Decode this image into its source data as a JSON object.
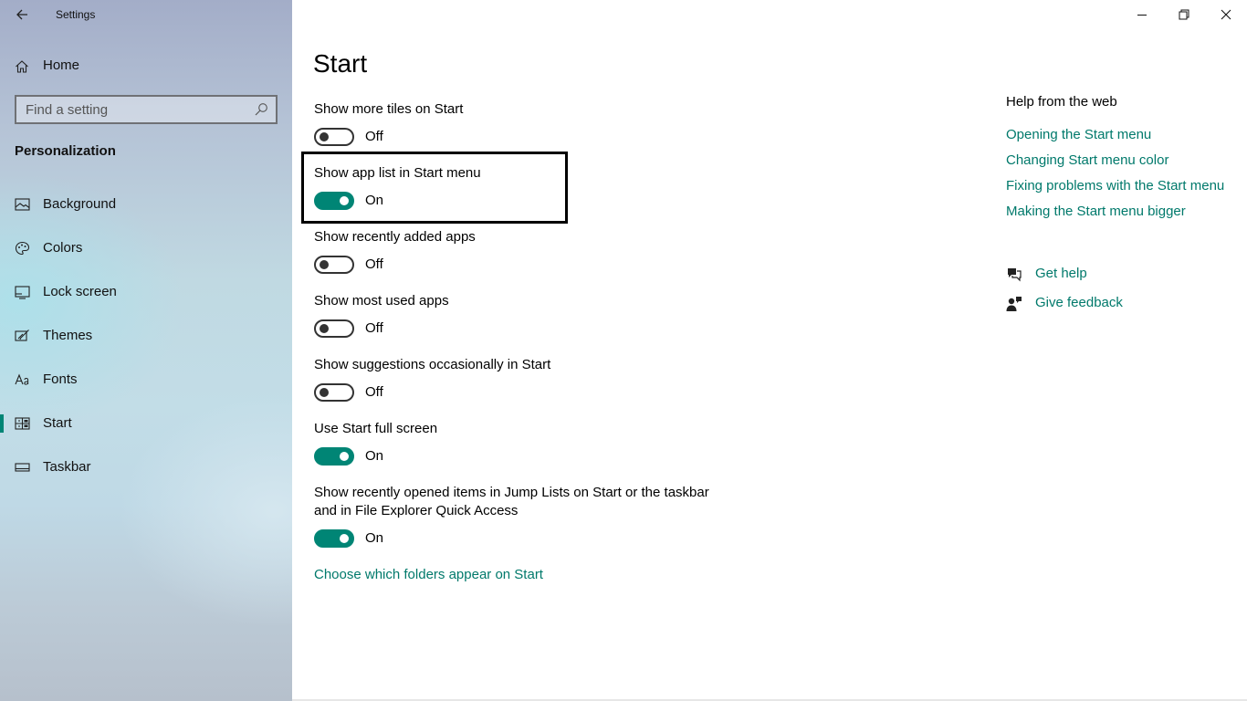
{
  "window": {
    "app_title": "Settings"
  },
  "sidebar": {
    "home_label": "Home",
    "search_placeholder": "Find a setting",
    "section_heading": "Personalization",
    "items": [
      {
        "label": "Background",
        "icon": "picture-icon"
      },
      {
        "label": "Colors",
        "icon": "palette-icon"
      },
      {
        "label": "Lock screen",
        "icon": "lock-screen-icon"
      },
      {
        "label": "Themes",
        "icon": "brush-icon"
      },
      {
        "label": "Fonts",
        "icon": "font-icon"
      },
      {
        "label": "Start",
        "icon": "start-tiles-icon",
        "active": true
      },
      {
        "label": "Taskbar",
        "icon": "taskbar-icon"
      }
    ]
  },
  "main": {
    "title": "Start",
    "settings": [
      {
        "label": "Show more tiles on Start",
        "state": "Off"
      },
      {
        "label": "Show app list in Start menu",
        "state": "On"
      },
      {
        "label": "Show recently added apps",
        "state": "Off"
      },
      {
        "label": "Show most used apps",
        "state": "Off"
      },
      {
        "label": "Show suggestions occasionally in Start",
        "state": "Off"
      },
      {
        "label": "Use Start full screen",
        "state": "On"
      },
      {
        "label_line1": "Show recently opened items in Jump Lists on Start or the taskbar",
        "label_line2": "and in File Explorer Quick Access",
        "state": "On"
      }
    ],
    "folders_link": "Choose which folders appear on Start"
  },
  "help": {
    "heading": "Help from the web",
    "links": [
      "Opening the Start menu",
      "Changing Start menu color",
      "Fixing problems with the Start menu",
      "Making the Start menu bigger"
    ],
    "get_help": "Get help",
    "give_feedback": "Give feedback"
  },
  "colors": {
    "accent": "#008575",
    "link": "#00796b"
  }
}
